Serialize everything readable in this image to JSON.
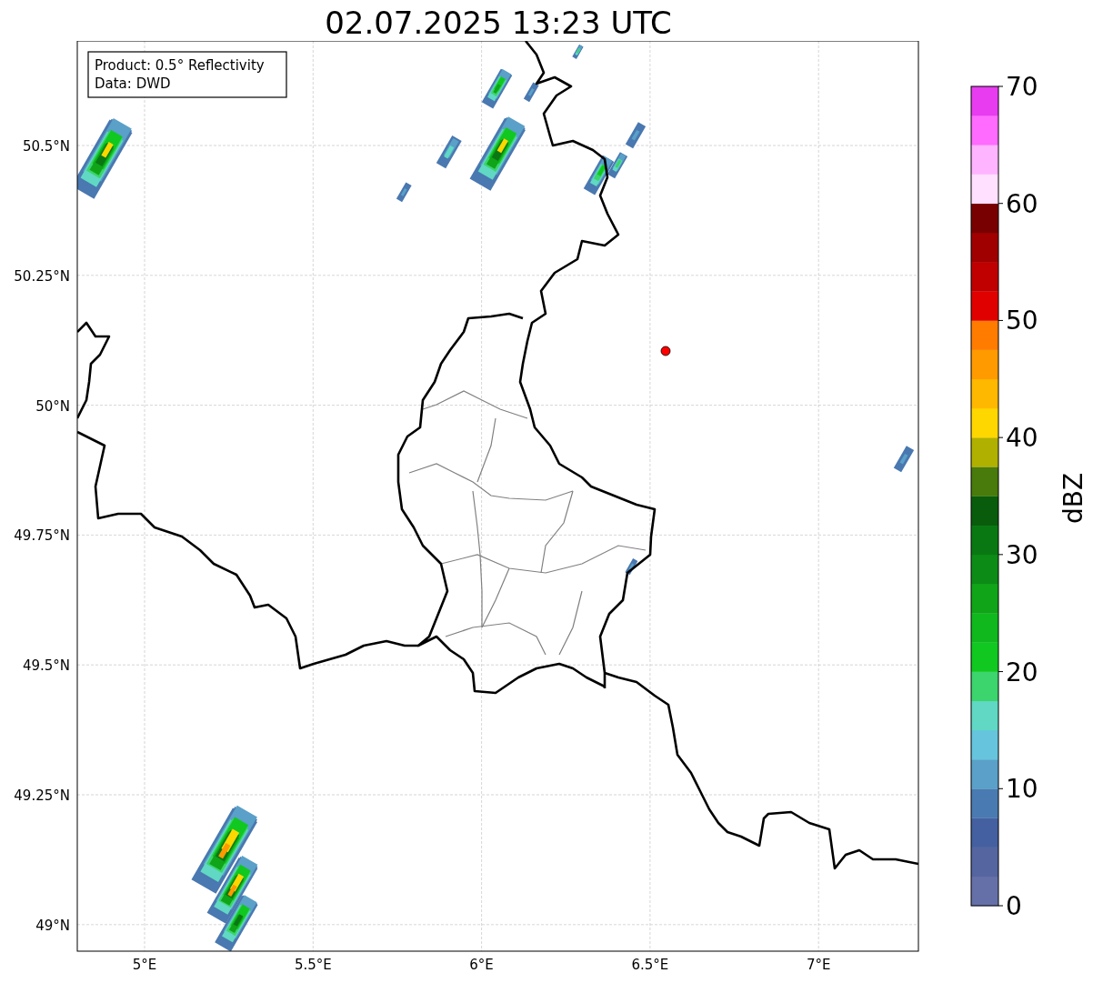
{
  "title": "02.07.2025 13:23 UTC",
  "info_box": {
    "lines": [
      "Product: 0.5° Reflectivity",
      "Data: DWD"
    ]
  },
  "map": {
    "lat_ticks": [
      "50.5°N",
      "50.25°N",
      "50°N",
      "49.75°N",
      "49.5°N",
      "49.25°N",
      "49°N"
    ],
    "lon_ticks": [
      "5°E",
      "5.5°E",
      "6°E",
      "6.5°E",
      "7°E"
    ]
  },
  "colorbar": {
    "label": "dBZ",
    "ticks": [
      "70",
      "60",
      "50",
      "40",
      "30",
      "20",
      "10",
      "0"
    ],
    "bins": [
      {
        "color": "#6670a8"
      },
      {
        "color": "#5565a0"
      },
      {
        "color": "#4560a0"
      },
      {
        "color": "#4a7ab2"
      },
      {
        "color": "#5aa0c8"
      },
      {
        "color": "#66c4dc"
      },
      {
        "color": "#60d8c4"
      },
      {
        "color": "#3cd46c"
      },
      {
        "color": "#10c820"
      },
      {
        "color": "#10b81e"
      },
      {
        "color": "#10a418"
      },
      {
        "color": "#0c8c16"
      },
      {
        "color": "#0a7812"
      },
      {
        "color": "#085c0c"
      },
      {
        "color": "#487a0c"
      },
      {
        "color": "#b0b000"
      },
      {
        "color": "#ffd700"
      },
      {
        "color": "#ffb800"
      },
      {
        "color": "#ff9a00"
      },
      {
        "color": "#ff7c00"
      },
      {
        "color": "#e00000"
      },
      {
        "color": "#c00000"
      },
      {
        "color": "#a00000"
      },
      {
        "color": "#780000"
      },
      {
        "color": "#ffe0ff"
      },
      {
        "color": "#ffb4ff"
      },
      {
        "color": "#ff6aff"
      },
      {
        "color": "#e83cf0"
      }
    ]
  }
}
